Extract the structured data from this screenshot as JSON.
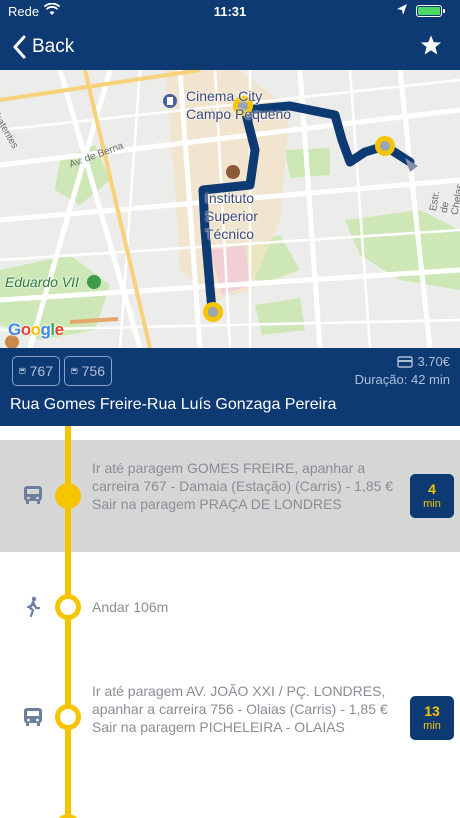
{
  "status_bar": {
    "carrier": "Rede",
    "time": "11:31"
  },
  "nav": {
    "back_label": "Back",
    "star_icon": "star-icon"
  },
  "map": {
    "place_labels": [
      "Cinema City",
      "Campo Pequeno",
      "Instituto",
      "Superior",
      "Técnico",
      "Eduardo VII"
    ],
    "street_labels": [
      "Av. de Berna",
      "Estr. de Chelas",
      "ombatentes"
    ],
    "attribution": "Google",
    "route_color": "#0e3a73",
    "stop_color": "#f6c500"
  },
  "summary": {
    "bus_chips": [
      "767",
      "756"
    ],
    "price": "3.70€",
    "duration": "Duração: 42 min",
    "route_name": "Rua Gomes Freire-Rua Luís Gonzaga Pereira"
  },
  "steps": [
    {
      "type": "bus",
      "icon": "bus-icon",
      "text": "Ir até paragem GOMES FREIRE, apanhar a carreira 767 - Damaia (Estação) (Carris) - 1,85 € Sair na paragem PRAÇA DE LONDRES",
      "badge_num": "4",
      "badge_unit": "min"
    },
    {
      "type": "walk",
      "icon": "walk-icon",
      "text": "Andar 106m"
    },
    {
      "type": "bus",
      "icon": "bus-icon",
      "text": "Ir até paragem AV. JOÃO XXI / PÇ. LONDRES, apanhar a carreira 756 - Olaias (Carris) - 1,85 € Sair na paragem PICHELEIRA - OLAIAS",
      "badge_num": "13",
      "badge_unit": "min"
    }
  ],
  "colors": {
    "header": "#0e3a73",
    "timeline": "#f6c500",
    "highlight": "#d6d6d6"
  }
}
